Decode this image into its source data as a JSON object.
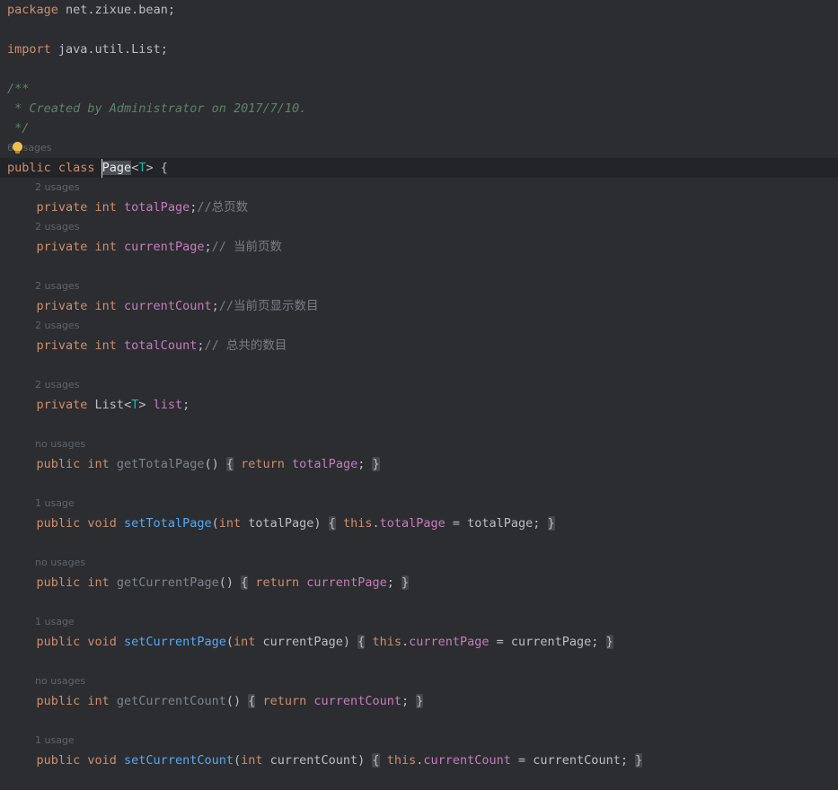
{
  "editor": {
    "colors": {
      "bg": "#2b2d30",
      "caretline": "#222427",
      "keyword": "#cf8e6d",
      "plain": "#bcbec4",
      "field": "#c77dbb",
      "method": "#57a8f5",
      "unused": "#7d848d",
      "comment": "#7a7e85",
      "doc": "#5f826b",
      "hint": "#5f646b",
      "typeparam": "#16baac",
      "foldbg": "#45474d",
      "idbox": "#4b4e55",
      "caret": "#d6d8dd",
      "bulb": "#f2c04d"
    },
    "lines": [
      {
        "k": "code",
        "seg": [
          {
            "t": "package ",
            "c": "keyword"
          },
          {
            "t": "net.zixue.bean;",
            "c": "plain"
          }
        ]
      },
      {
        "k": "blank"
      },
      {
        "k": "code",
        "seg": [
          {
            "t": "import ",
            "c": "keyword"
          },
          {
            "t": "java.util.List;",
            "c": "plain"
          }
        ]
      },
      {
        "k": "blank"
      },
      {
        "k": "code",
        "seg": [
          {
            "t": "/**",
            "c": "doc"
          }
        ]
      },
      {
        "k": "code",
        "seg": [
          {
            "t": " * Created by Administrator on 2017/7/10.",
            "c": "doc"
          }
        ]
      },
      {
        "k": "code",
        "seg": [
          {
            "t": " */",
            "c": "doc"
          }
        ]
      },
      {
        "k": "hint",
        "bulb": true,
        "seg": [
          {
            "t": "6 usages",
            "c": "hint"
          }
        ]
      },
      {
        "k": "code",
        "caret": true,
        "seg": [
          {
            "t": "public class ",
            "c": "keyword"
          },
          {
            "t": "Page",
            "c": "plain",
            "b": 1
          },
          {
            "t": "<",
            "c": "plain"
          },
          {
            "t": "T",
            "c": "typeparam"
          },
          {
            "t": "> {",
            "c": "plain"
          }
        ]
      },
      {
        "k": "hint",
        "ind": 1,
        "seg": [
          {
            "t": "2 usages",
            "c": "hint"
          }
        ]
      },
      {
        "k": "code",
        "seg": [
          {
            "t": "    private int ",
            "c": "keyword"
          },
          {
            "t": "totalPage",
            "c": "field"
          },
          {
            "t": ";",
            "c": "plain"
          },
          {
            "t": "//总页数",
            "c": "comment"
          }
        ]
      },
      {
        "k": "hint",
        "ind": 1,
        "seg": [
          {
            "t": "2 usages",
            "c": "hint"
          }
        ]
      },
      {
        "k": "code",
        "seg": [
          {
            "t": "    private int ",
            "c": "keyword"
          },
          {
            "t": "currentPage",
            "c": "field"
          },
          {
            "t": ";",
            "c": "plain"
          },
          {
            "t": "// 当前页数",
            "c": "comment"
          }
        ]
      },
      {
        "k": "blank"
      },
      {
        "k": "hint",
        "ind": 1,
        "seg": [
          {
            "t": "2 usages",
            "c": "hint"
          }
        ]
      },
      {
        "k": "code",
        "seg": [
          {
            "t": "    private int ",
            "c": "keyword"
          },
          {
            "t": "currentCount",
            "c": "field"
          },
          {
            "t": ";",
            "c": "plain"
          },
          {
            "t": "//当前页显示数目",
            "c": "comment"
          }
        ]
      },
      {
        "k": "hint",
        "ind": 1,
        "seg": [
          {
            "t": "2 usages",
            "c": "hint"
          }
        ]
      },
      {
        "k": "code",
        "seg": [
          {
            "t": "    private int ",
            "c": "keyword"
          },
          {
            "t": "totalCount",
            "c": "field"
          },
          {
            "t": ";",
            "c": "plain"
          },
          {
            "t": "// 总共的数目",
            "c": "comment"
          }
        ]
      },
      {
        "k": "blank"
      },
      {
        "k": "hint",
        "ind": 1,
        "seg": [
          {
            "t": "2 usages",
            "c": "hint"
          }
        ]
      },
      {
        "k": "code",
        "seg": [
          {
            "t": "    private ",
            "c": "keyword"
          },
          {
            "t": "List",
            "c": "plain"
          },
          {
            "t": "<",
            "c": "plain"
          },
          {
            "t": "T",
            "c": "typeparam"
          },
          {
            "t": "> ",
            "c": "plain"
          },
          {
            "t": "list",
            "c": "field"
          },
          {
            "t": ";",
            "c": "plain"
          }
        ]
      },
      {
        "k": "blank"
      },
      {
        "k": "hint",
        "ind": 1,
        "seg": [
          {
            "t": "no usages",
            "c": "hint"
          }
        ]
      },
      {
        "k": "code",
        "seg": [
          {
            "t": "    public int ",
            "c": "keyword"
          },
          {
            "t": "getTotalPage",
            "c": "unused"
          },
          {
            "t": "() ",
            "c": "plain"
          },
          {
            "t": "{",
            "c": "plain",
            "f": 1
          },
          {
            "t": " ",
            "c": "plain"
          },
          {
            "t": "return ",
            "c": "keyword"
          },
          {
            "t": "totalPage",
            "c": "field"
          },
          {
            "t": "; ",
            "c": "plain"
          },
          {
            "t": "}",
            "c": "plain",
            "f": 1
          }
        ]
      },
      {
        "k": "blank"
      },
      {
        "k": "hint",
        "ind": 1,
        "seg": [
          {
            "t": "1 usage",
            "c": "hint"
          }
        ]
      },
      {
        "k": "code",
        "seg": [
          {
            "t": "    public void ",
            "c": "keyword"
          },
          {
            "t": "setTotalPage",
            "c": "method"
          },
          {
            "t": "(",
            "c": "plain"
          },
          {
            "t": "int",
            "c": "keyword"
          },
          {
            "t": " totalPage) ",
            "c": "plain"
          },
          {
            "t": "{",
            "c": "plain",
            "f": 1
          },
          {
            "t": " ",
            "c": "plain"
          },
          {
            "t": "this",
            "c": "keyword"
          },
          {
            "t": ".",
            "c": "plain"
          },
          {
            "t": "totalPage",
            "c": "field"
          },
          {
            "t": " = totalPage; ",
            "c": "plain"
          },
          {
            "t": "}",
            "c": "plain",
            "f": 1
          }
        ]
      },
      {
        "k": "blank"
      },
      {
        "k": "hint",
        "ind": 1,
        "seg": [
          {
            "t": "no usages",
            "c": "hint"
          }
        ]
      },
      {
        "k": "code",
        "seg": [
          {
            "t": "    public int ",
            "c": "keyword"
          },
          {
            "t": "getCurrentPage",
            "c": "unused"
          },
          {
            "t": "() ",
            "c": "plain"
          },
          {
            "t": "{",
            "c": "plain",
            "f": 1
          },
          {
            "t": " ",
            "c": "plain"
          },
          {
            "t": "return ",
            "c": "keyword"
          },
          {
            "t": "currentPage",
            "c": "field"
          },
          {
            "t": "; ",
            "c": "plain"
          },
          {
            "t": "}",
            "c": "plain",
            "f": 1
          }
        ]
      },
      {
        "k": "blank"
      },
      {
        "k": "hint",
        "ind": 1,
        "seg": [
          {
            "t": "1 usage",
            "c": "hint"
          }
        ]
      },
      {
        "k": "code",
        "seg": [
          {
            "t": "    public void ",
            "c": "keyword"
          },
          {
            "t": "setCurrentPage",
            "c": "method"
          },
          {
            "t": "(",
            "c": "plain"
          },
          {
            "t": "int",
            "c": "keyword"
          },
          {
            "t": " currentPage) ",
            "c": "plain"
          },
          {
            "t": "{",
            "c": "plain",
            "f": 1
          },
          {
            "t": " ",
            "c": "plain"
          },
          {
            "t": "this",
            "c": "keyword"
          },
          {
            "t": ".",
            "c": "plain"
          },
          {
            "t": "currentPage",
            "c": "field"
          },
          {
            "t": " = currentPage; ",
            "c": "plain"
          },
          {
            "t": "}",
            "c": "plain",
            "f": 1
          }
        ]
      },
      {
        "k": "blank"
      },
      {
        "k": "hint",
        "ind": 1,
        "seg": [
          {
            "t": "no usages",
            "c": "hint"
          }
        ]
      },
      {
        "k": "code",
        "seg": [
          {
            "t": "    public int ",
            "c": "keyword"
          },
          {
            "t": "getCurrentCount",
            "c": "unused"
          },
          {
            "t": "() ",
            "c": "plain"
          },
          {
            "t": "{",
            "c": "plain",
            "f": 1
          },
          {
            "t": " ",
            "c": "plain"
          },
          {
            "t": "return ",
            "c": "keyword"
          },
          {
            "t": "currentCount",
            "c": "field"
          },
          {
            "t": "; ",
            "c": "plain"
          },
          {
            "t": "}",
            "c": "plain",
            "f": 1
          }
        ]
      },
      {
        "k": "blank"
      },
      {
        "k": "hint",
        "ind": 1,
        "seg": [
          {
            "t": "1 usage",
            "c": "hint"
          }
        ]
      },
      {
        "k": "code",
        "seg": [
          {
            "t": "    public void ",
            "c": "keyword"
          },
          {
            "t": "setCurrentCount",
            "c": "method"
          },
          {
            "t": "(",
            "c": "plain"
          },
          {
            "t": "int",
            "c": "keyword"
          },
          {
            "t": " currentCount) ",
            "c": "plain"
          },
          {
            "t": "{",
            "c": "plain",
            "f": 1
          },
          {
            "t": " ",
            "c": "plain"
          },
          {
            "t": "this",
            "c": "keyword"
          },
          {
            "t": ".",
            "c": "plain"
          },
          {
            "t": "currentCount",
            "c": "field"
          },
          {
            "t": " = currentCount; ",
            "c": "plain"
          },
          {
            "t": "}",
            "c": "plain",
            "f": 1
          }
        ]
      },
      {
        "k": "blank"
      }
    ]
  }
}
